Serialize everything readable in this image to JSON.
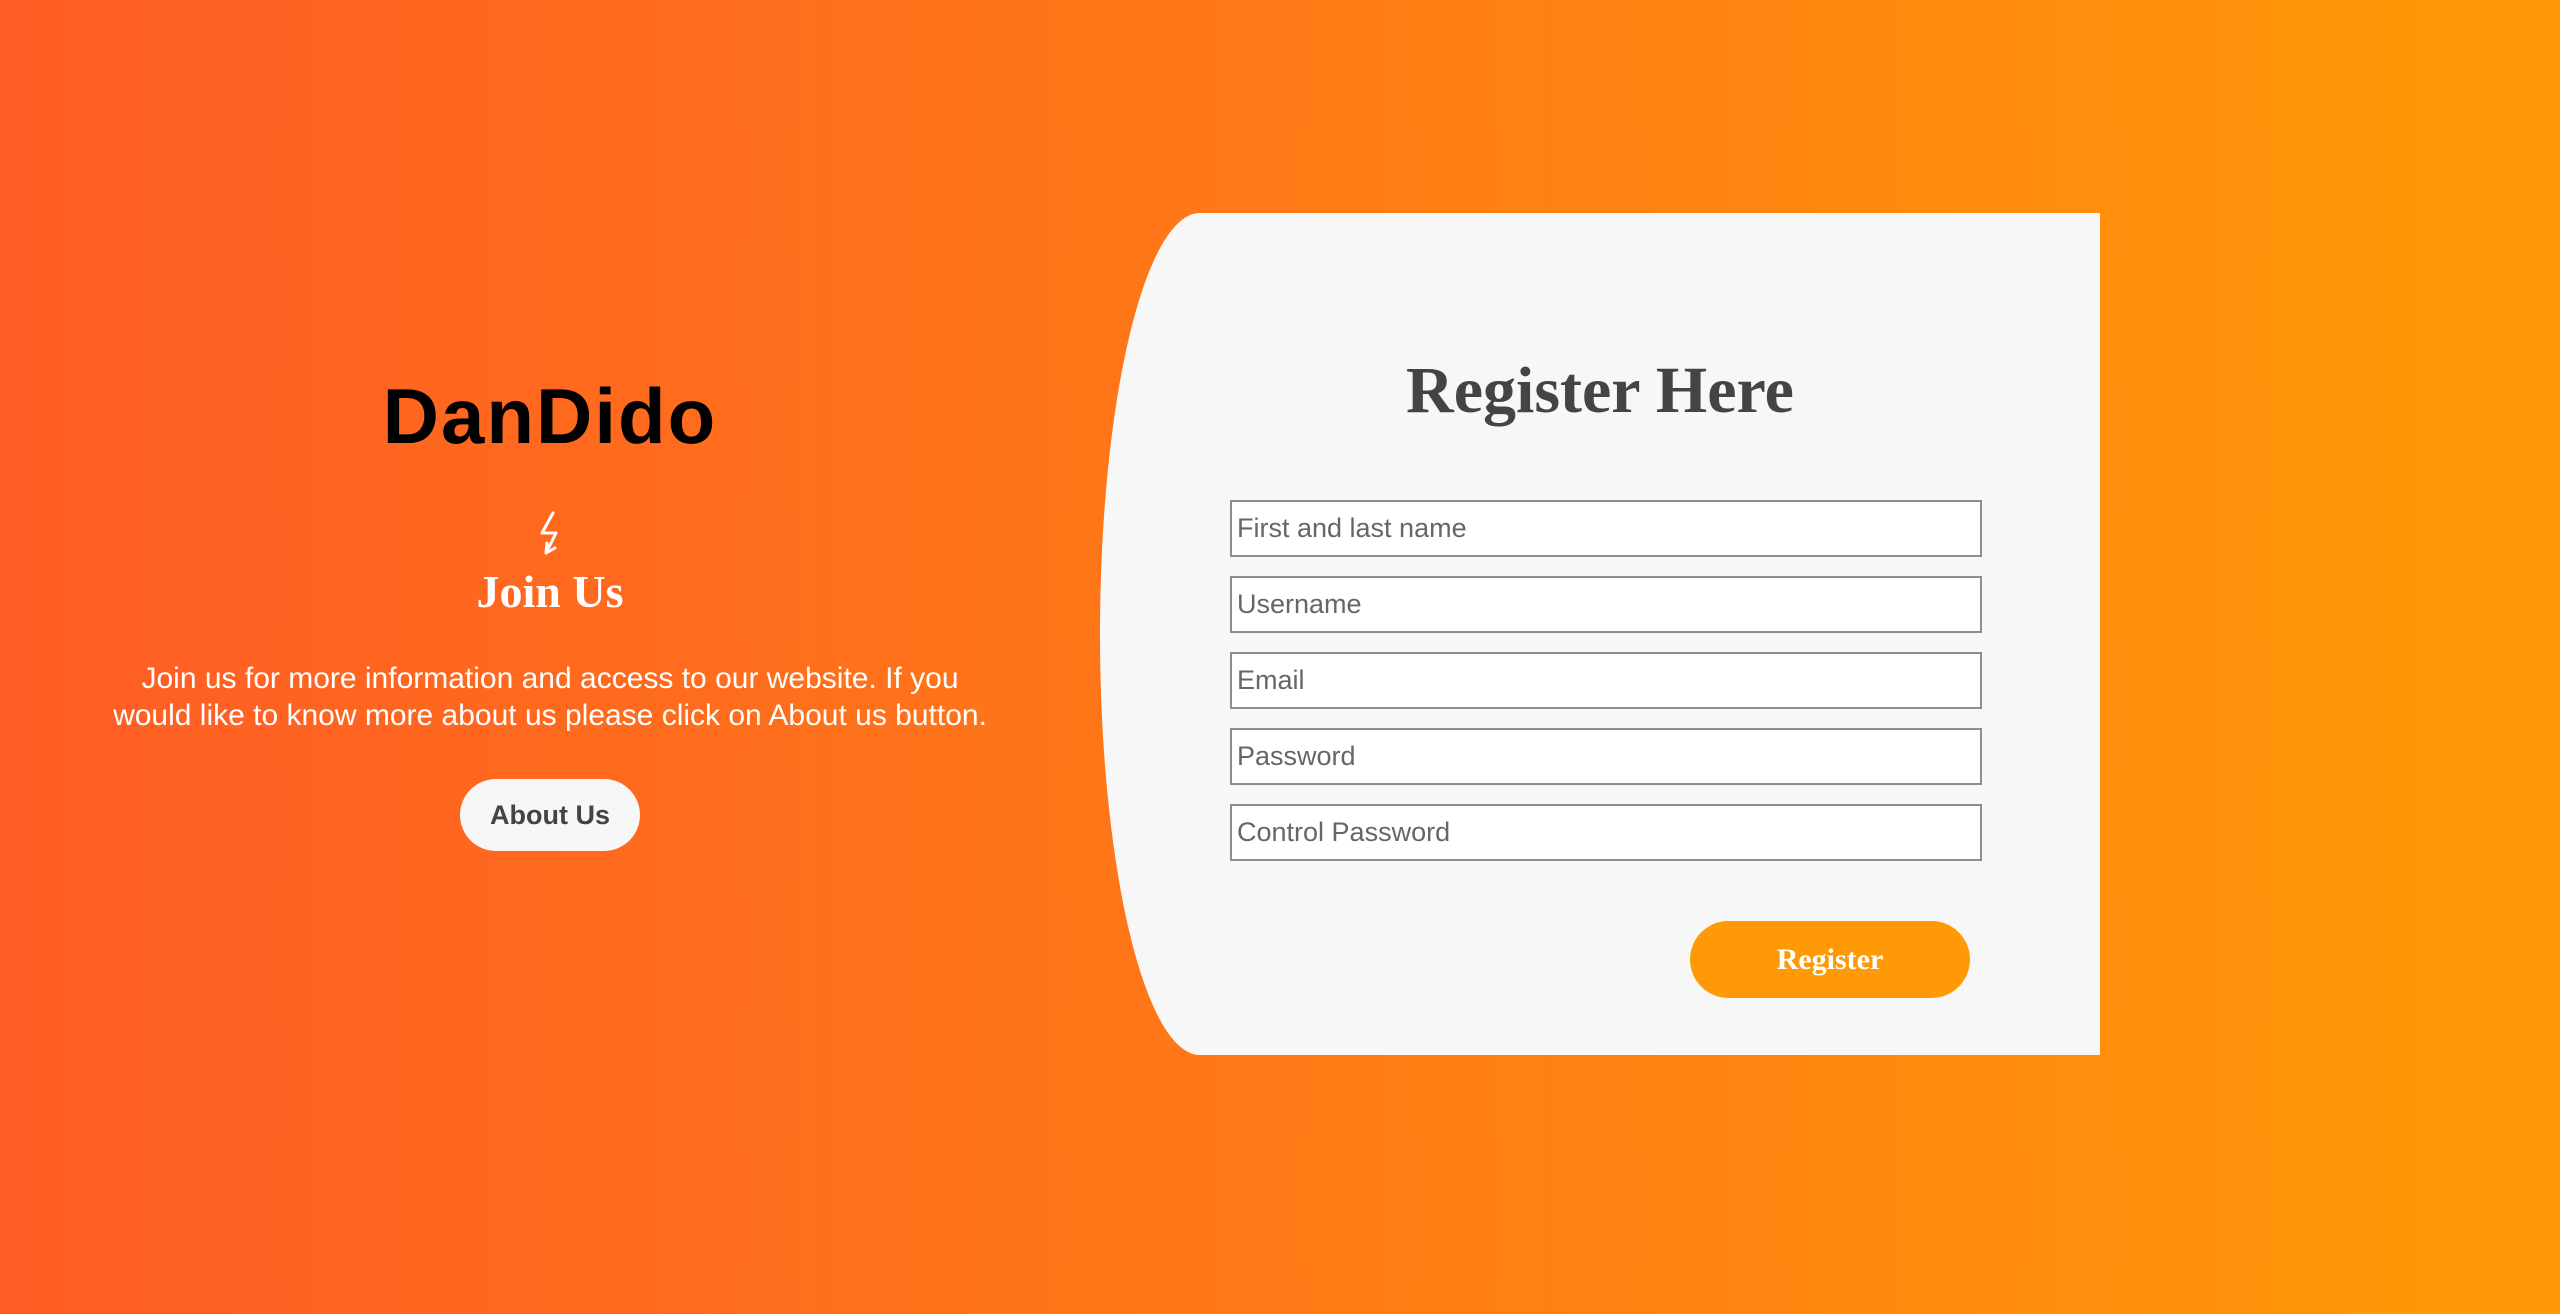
{
  "colors": {
    "gradient_start": "#ff5c25",
    "gradient_end": "#ff9a06",
    "panel_background": "#f7f7f7",
    "heading_text": "#444444",
    "register_button": "#ff9a06"
  },
  "brand": {
    "name": "DanDido"
  },
  "join": {
    "icon": "lightning-bolt-icon",
    "title": "Join Us",
    "description": "Join us for more information and access to our website. If you would like to know more about us please click on About us button.",
    "button_label": "About Us"
  },
  "register": {
    "title": "Register Here",
    "fields": [
      {
        "placeholder": "First and last name",
        "value": ""
      },
      {
        "placeholder": "Username",
        "value": ""
      },
      {
        "placeholder": "Email",
        "value": ""
      },
      {
        "placeholder": "Password",
        "value": ""
      },
      {
        "placeholder": "Control Password",
        "value": ""
      }
    ],
    "button_label": "Register"
  }
}
